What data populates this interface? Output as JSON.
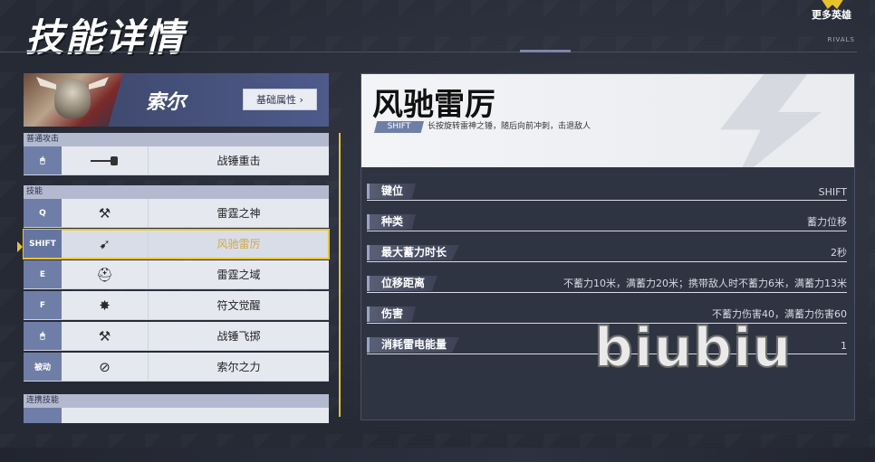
{
  "page": {
    "title": "技能详情"
  },
  "brand": {
    "more_heroes": "更多英雄",
    "rivals": "RIVALS"
  },
  "hero": {
    "name": "索尔",
    "attributes_button": "基础属性 ›"
  },
  "sections": {
    "normal_attack": "普通攻击",
    "skills": "技能",
    "team_up": "连携技能"
  },
  "normal_attack_rows": [
    {
      "key": "🖱",
      "icon": "mouse-left-icon",
      "name": "战锤重击"
    }
  ],
  "skill_rows": [
    {
      "key": "Q",
      "icon": "thunder-god-icon",
      "name": "雷霆之神"
    },
    {
      "key": "SHIFT",
      "icon": "wind-dash-icon",
      "name": "风驰雷厉"
    },
    {
      "key": "E",
      "icon": "thunder-field-icon",
      "name": "雷霆之域"
    },
    {
      "key": "F",
      "icon": "rune-awaken-icon",
      "name": "符文觉醒"
    },
    {
      "key": "🖱",
      "icon": "hammer-throw-icon",
      "name": "战锤飞掷"
    },
    {
      "key": "被动",
      "icon": "passive-bolt-icon",
      "name": "索尔之力"
    }
  ],
  "active_skill_index": 1,
  "detail": {
    "title": "风驰雷厉",
    "key_tag": "SHIFT",
    "description": "长按旋转雷神之锤，随后向前冲刺，击退敌人",
    "properties": [
      {
        "label": "键位",
        "value": "SHIFT"
      },
      {
        "label": "种类",
        "value": "蓄力位移"
      },
      {
        "label": "最大蓄力时长",
        "value": "2秒"
      },
      {
        "label": "位移距离",
        "value": "不蓄力10米，满蓄力20米；携带敌人时不蓄力6米，满蓄力13米"
      },
      {
        "label": "伤害",
        "value": "不蓄力伤害40，满蓄力伤害60"
      },
      {
        "label": "消耗雷电能量",
        "value": "1"
      }
    ]
  },
  "watermark": "biubiu",
  "colors": {
    "accent": "#e6c336",
    "key_bg": "#6f7ea7",
    "panel_dark": "#2f3442"
  }
}
